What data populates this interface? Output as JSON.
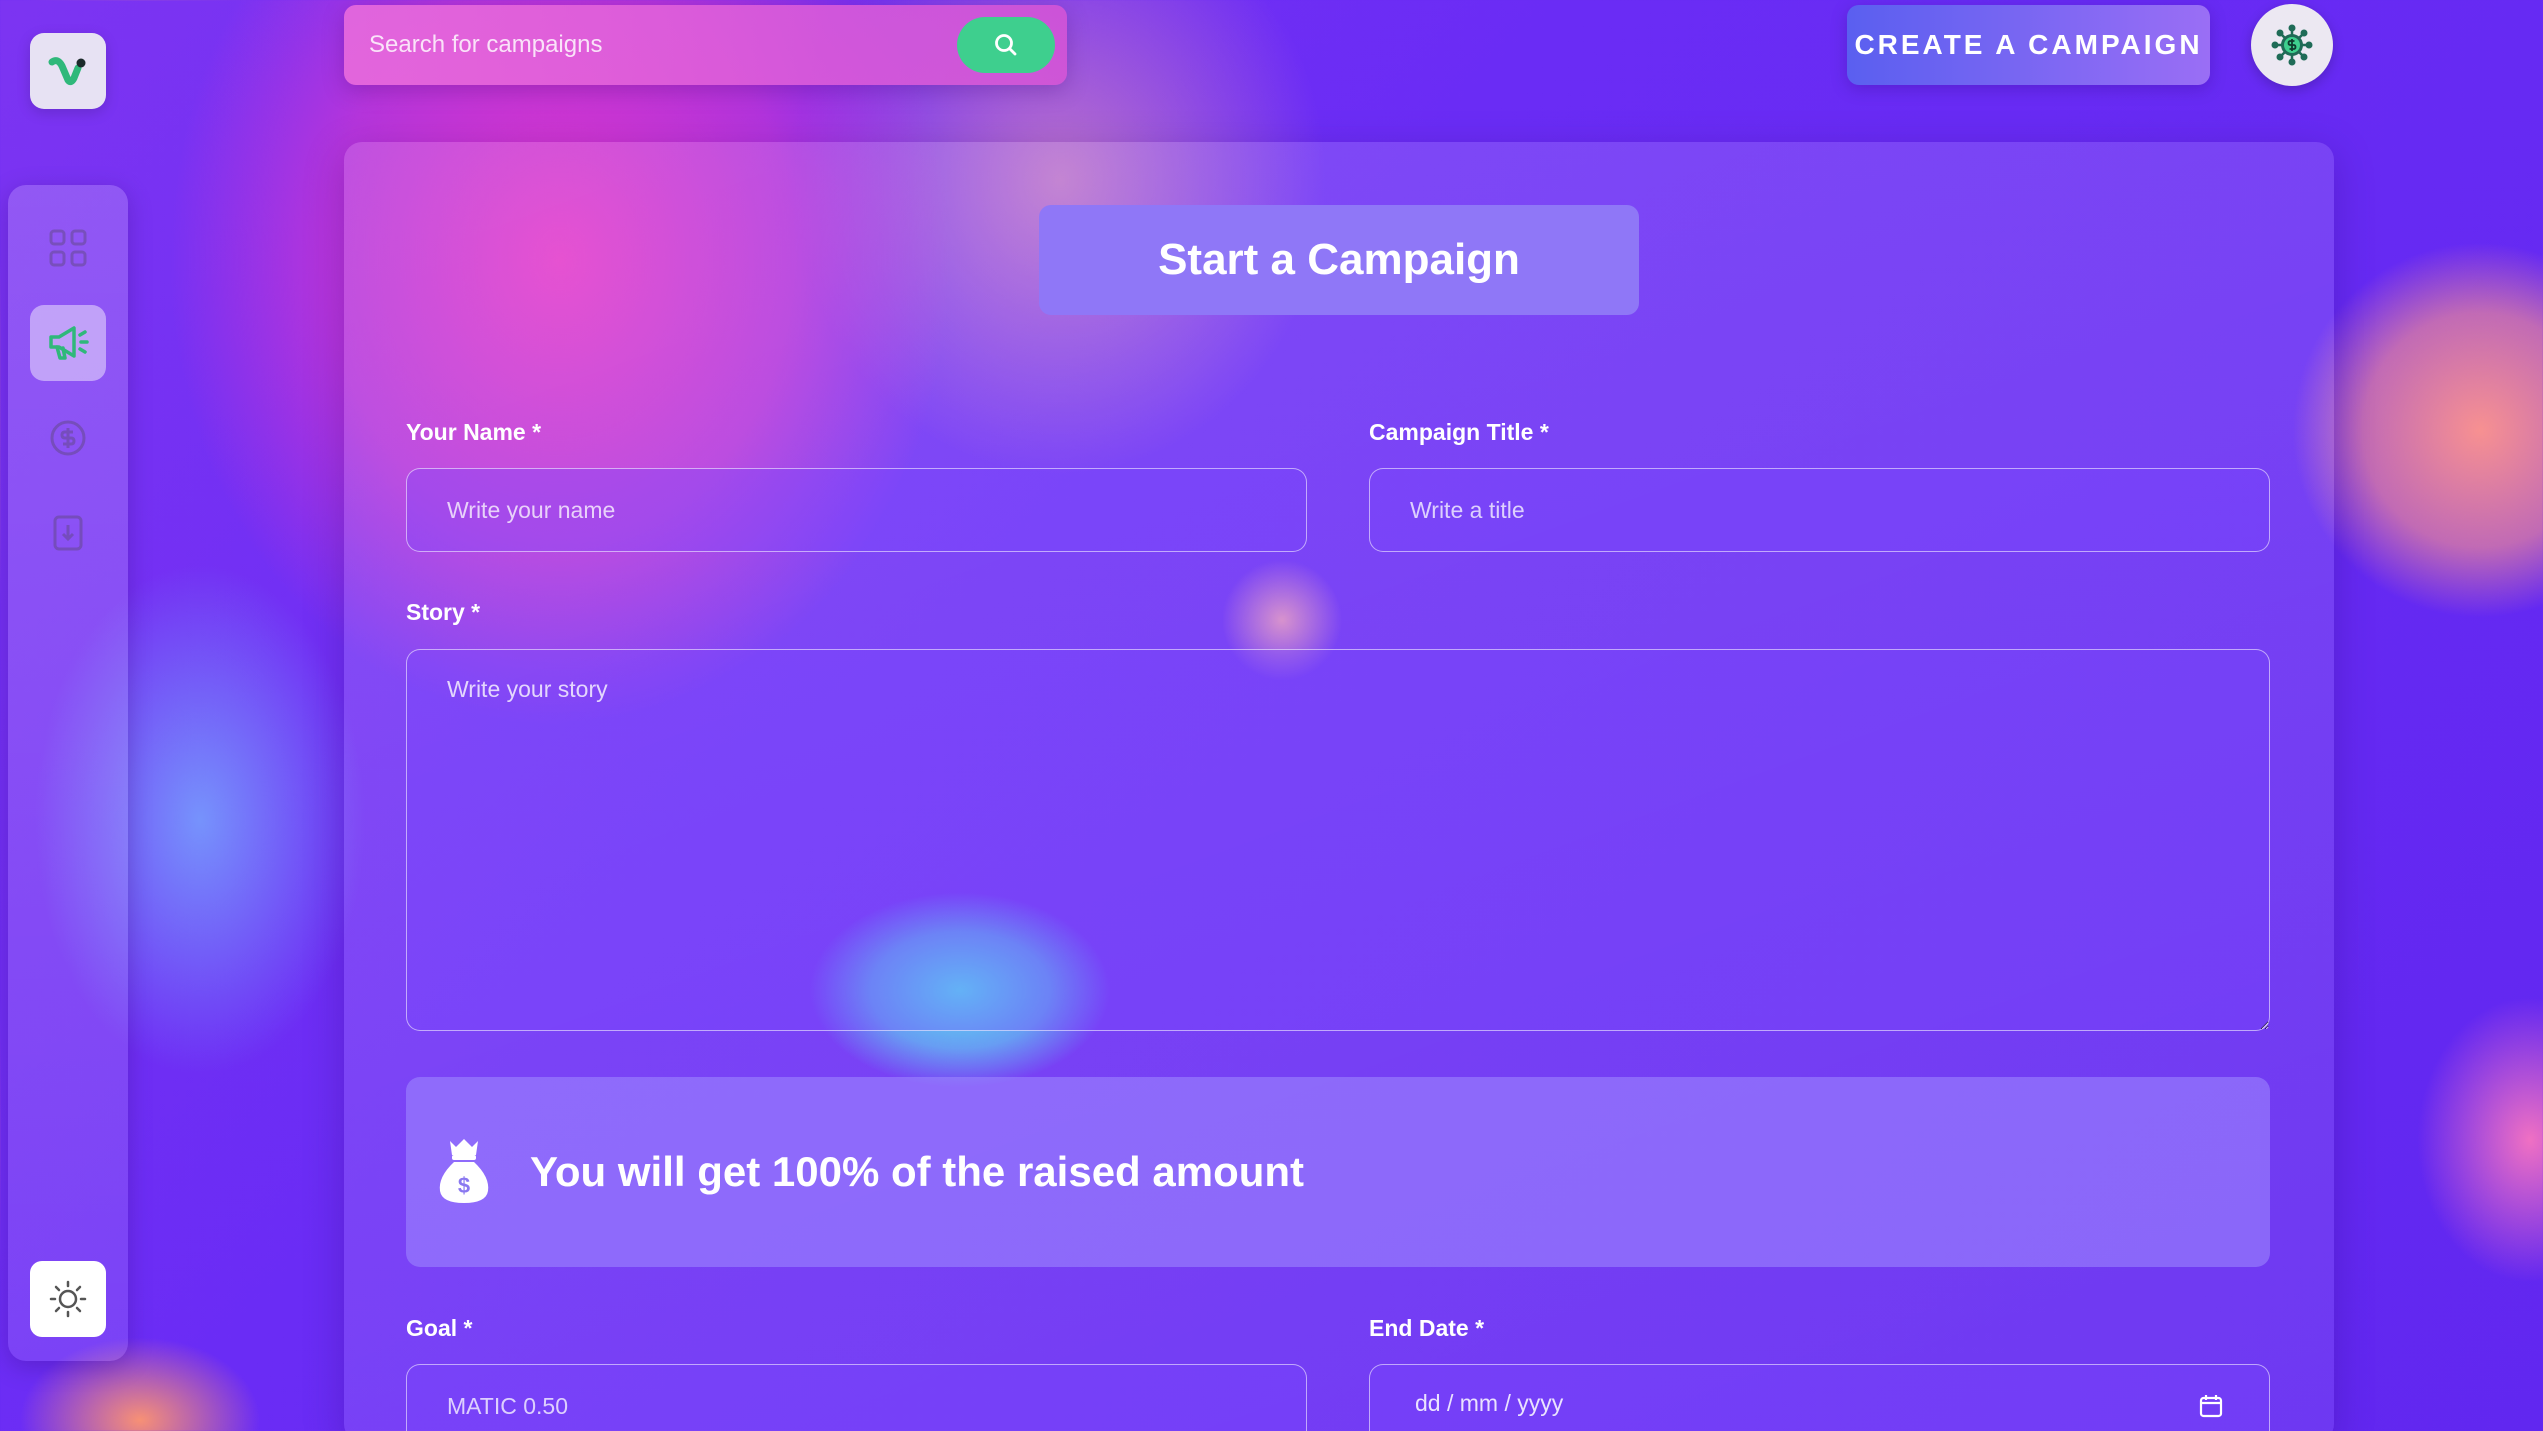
{
  "app": {
    "colors": {
      "accent_green": "#3ecf8e",
      "card_title_bg": "#8f77f7",
      "background": "#6a2cf5"
    }
  },
  "sidebar": {
    "logo_icon": "v-logo-icon",
    "items": [
      {
        "name": "dashboard",
        "icon": "dashboard-icon",
        "active": false
      },
      {
        "name": "campaigns",
        "icon": "megaphone-icon",
        "active": true
      },
      {
        "name": "payments",
        "icon": "coin-icon",
        "active": false
      },
      {
        "name": "withdraw",
        "icon": "withdraw-icon",
        "active": false
      }
    ],
    "theme_toggle_icon": "sun-icon"
  },
  "header": {
    "search": {
      "placeholder": "Search for campaigns",
      "icon": "search-icon"
    },
    "create_label": "CREATE A CAMPAIGN",
    "profile_icon": "profile-icon"
  },
  "form": {
    "title": "Start a Campaign",
    "name": {
      "label": "Your Name *",
      "placeholder": "Write your name"
    },
    "campaign_title": {
      "label": "Campaign Title *",
      "placeholder": "Write a title"
    },
    "story": {
      "label": "Story *",
      "placeholder": "Write your story"
    },
    "banner": {
      "text": "You will get 100% of the raised amount",
      "icon": "money-bag-icon"
    },
    "goal": {
      "label": "Goal *",
      "placeholder": "MATIC 0.50"
    },
    "end_date": {
      "label": "End Date *",
      "placeholder": "dd / mm / yyyy",
      "icon": "calendar-icon"
    }
  }
}
